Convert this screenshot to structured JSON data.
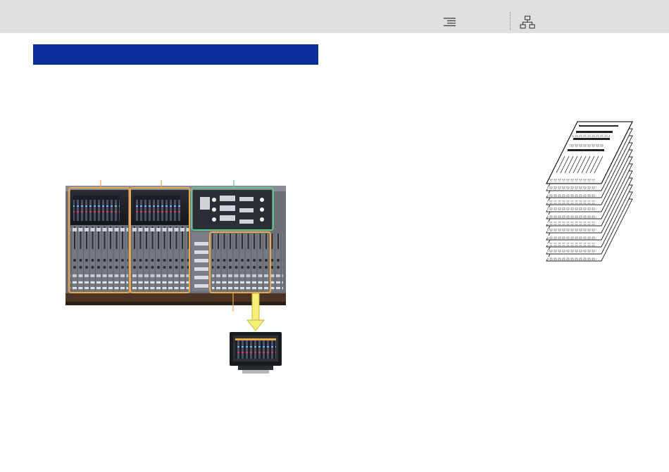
{
  "header": {
    "toc_icon": "table-of-contents-icon",
    "nav_icon": "sitemap-icon",
    "background": "#e0e0e1"
  },
  "section_bar": {
    "color": "#0a2f9a",
    "title": ""
  },
  "figure_console": {
    "highlight_colors": {
      "bay_frame": "#f0a64a",
      "center_frame": "#5ec48a",
      "arrow": "#f5f07a"
    },
    "images": [
      "mixing-console-illustration",
      "external-monitor-illustration"
    ]
  },
  "figure_layers": {
    "images": [
      "fader-layer-stack-illustration"
    ]
  }
}
